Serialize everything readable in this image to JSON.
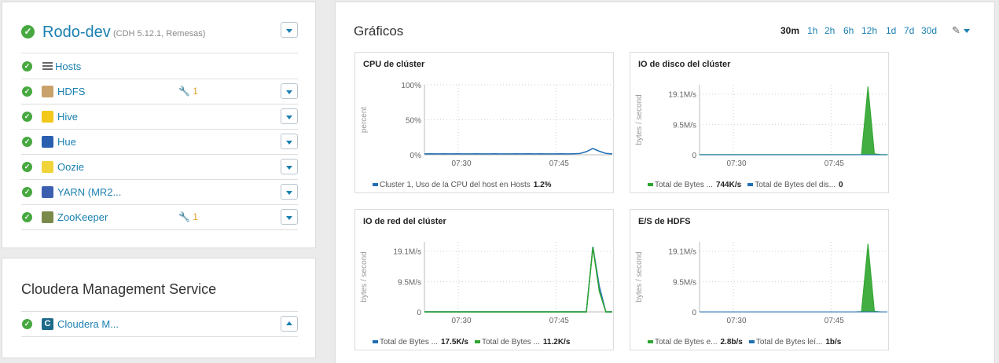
{
  "cluster": {
    "name": "Rodo-dev",
    "subtitle": "(CDH 5.12.1, Remesas)",
    "hosts_label": "Hosts",
    "services": [
      {
        "name": "HDFS",
        "icon": "hdfs-icon",
        "badge": "1",
        "icon_color": "#c8a26a"
      },
      {
        "name": "Hive",
        "icon": "hive-icon",
        "badge": "",
        "icon_color": "#f2c81a"
      },
      {
        "name": "Hue",
        "icon": "hue-icon",
        "badge": "",
        "icon_color": "#2a5fb0"
      },
      {
        "name": "Oozie",
        "icon": "oozie-icon",
        "badge": "",
        "icon_color": "#f0d43a"
      },
      {
        "name": "YARN (MR2...",
        "icon": "yarn-icon",
        "badge": "",
        "icon_color": "#3c5fb0"
      },
      {
        "name": "ZooKeeper",
        "icon": "zookeeper-icon",
        "badge": "1",
        "icon_color": "#7a8a4a"
      }
    ]
  },
  "management": {
    "title": "Cloudera Management Service",
    "service": {
      "name": "Cloudera M...",
      "icon": "cloudera-icon",
      "icon_color": "#1d6a8a"
    }
  },
  "charts_panel": {
    "title": "Gráficos",
    "ranges": [
      "30m",
      "1h",
      "2h",
      "6h",
      "12h",
      "1d",
      "7d",
      "30d"
    ],
    "active_range": "30m"
  },
  "colors": {
    "link": "#1a7fb0",
    "ok": "#46a83f",
    "series_blue": "#1f6fb5",
    "series_green": "#2ea52e"
  },
  "chart_data": [
    {
      "type": "line",
      "title": "CPU de clúster",
      "ylabel": "percent",
      "yticks": [
        "100%",
        "50%",
        "0%"
      ],
      "xticks": [
        "07:30",
        "07:45"
      ],
      "ylim": [
        0,
        100
      ],
      "series": [
        {
          "name": "Cluster 1, Uso de la CPU del host en Hosts",
          "value_label": "1.2%",
          "color": "#1f6fb5",
          "values": [
            1.2,
            1.3,
            1.2,
            1.4,
            1.2,
            1.3,
            1.2,
            1.2,
            1.3,
            1.2,
            1.2,
            1.3,
            1.2,
            1.2,
            1.3,
            1.2,
            1.4,
            1.2,
            1.3,
            1.2,
            1.2,
            1.3,
            1.2,
            1.5,
            1.8,
            4.5,
            9,
            5,
            2,
            1.2
          ]
        }
      ]
    },
    {
      "type": "area",
      "title": "IO de disco del clúster",
      "ylabel": "bytes / second",
      "yticks": [
        "19.1M/s",
        "9.5M/s",
        "0"
      ],
      "xticks": [
        "07:30",
        "07:45"
      ],
      "ylim": [
        0,
        22
      ],
      "series": [
        {
          "name": "Total de Bytes ...",
          "value_label": "744K/s",
          "color": "#2ea52e",
          "values": [
            0.05,
            0.05,
            0.05,
            0.05,
            0.05,
            0.05,
            0.05,
            0.05,
            0.05,
            0.05,
            0.05,
            0.05,
            0.05,
            0.05,
            0.05,
            0.05,
            0.05,
            0.05,
            0.05,
            0.05,
            0.05,
            0.05,
            0.05,
            0.05,
            0.05,
            0.1,
            21.5,
            0.3,
            0.05,
            0.05
          ]
        },
        {
          "name": "Total de Bytes del dis...",
          "value_label": "0",
          "color": "#1f6fb5",
          "values": [
            0,
            0,
            0,
            0,
            0,
            0,
            0,
            0,
            0,
            0,
            0,
            0,
            0,
            0,
            0,
            0,
            0,
            0,
            0,
            0,
            0,
            0,
            0,
            0,
            0,
            0,
            0,
            0,
            0,
            0
          ]
        }
      ]
    },
    {
      "type": "line",
      "title": "IO de red del clúster",
      "ylabel": "bytes / second",
      "yticks": [
        "19.1M/s",
        "9.5M/s",
        "0"
      ],
      "xticks": [
        "07:30",
        "07:45"
      ],
      "ylim": [
        0,
        22
      ],
      "series": [
        {
          "name": "Total de Bytes ...",
          "value_label": "17.5K/s",
          "color": "#1f6fb5",
          "values": [
            0.02,
            0.02,
            0.02,
            0.02,
            0.02,
            0.02,
            0.02,
            0.02,
            0.02,
            0.02,
            0.02,
            0.02,
            0.02,
            0.02,
            0.02,
            0.02,
            0.02,
            0.02,
            0.02,
            0.02,
            0.02,
            0.02,
            0.02,
            0.02,
            0.02,
            0.02,
            20.5,
            8,
            0.02,
            0.02
          ]
        },
        {
          "name": "Total de Bytes ...",
          "value_label": "11.2K/s",
          "color": "#2ea52e",
          "values": [
            0.01,
            0.01,
            0.01,
            0.01,
            0.01,
            0.01,
            0.01,
            0.01,
            0.01,
            0.01,
            0.01,
            0.01,
            0.01,
            0.01,
            0.01,
            0.01,
            0.01,
            0.01,
            0.01,
            0.01,
            0.01,
            0.01,
            0.01,
            0.01,
            0.01,
            0.01,
            20.3,
            6.5,
            0.01,
            0.01
          ]
        }
      ]
    },
    {
      "type": "area",
      "title": "E/S de HDFS",
      "ylabel": "bytes / second",
      "yticks": [
        "19.1M/s",
        "9.5M/s",
        "0"
      ],
      "xticks": [
        "07:30",
        "07:45"
      ],
      "ylim": [
        0,
        22
      ],
      "series": [
        {
          "name": "Total de Bytes e...",
          "value_label": "2.8b/s",
          "color": "#2ea52e",
          "values": [
            0,
            0,
            0,
            0,
            0,
            0,
            0,
            0,
            0,
            0,
            0,
            0,
            0,
            0,
            0,
            0,
            0,
            0,
            0,
            0,
            0,
            0,
            0,
            0,
            0,
            0.1,
            21.5,
            0.2,
            0,
            0
          ]
        },
        {
          "name": "Total de Bytes leí...",
          "value_label": "1b/s",
          "color": "#1f6fb5",
          "values": [
            0,
            0,
            0,
            0,
            0,
            0,
            0,
            0,
            0,
            0,
            0,
            0,
            0,
            0,
            0,
            0,
            0,
            0,
            0,
            0,
            0,
            0,
            0,
            0,
            0,
            0,
            0,
            0,
            0,
            0
          ]
        }
      ]
    }
  ]
}
